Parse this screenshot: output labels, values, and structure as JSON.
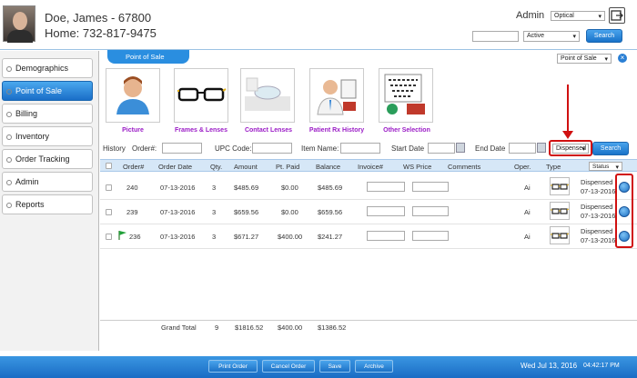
{
  "patient": {
    "name": "Doe, James - 67800",
    "home": "Home: 732-817-9475"
  },
  "header": {
    "admin_label": "Admin",
    "location_value": "Optical",
    "status_value": "Active",
    "search_label": "Search"
  },
  "sidebar": {
    "items": [
      {
        "label": "Demographics"
      },
      {
        "label": "Point of Sale"
      },
      {
        "label": "Billing"
      },
      {
        "label": "Inventory"
      },
      {
        "label": "Order Tracking"
      },
      {
        "label": "Admin"
      },
      {
        "label": "Reports"
      }
    ]
  },
  "pos": {
    "tab_label": "Point of Sale",
    "view_select": "Point of Sale"
  },
  "tiles": [
    {
      "label": "Picture"
    },
    {
      "label": "Frames & Lenses"
    },
    {
      "label": "Contact Lenses"
    },
    {
      "label": "Patient Rx History"
    },
    {
      "label": "Other Selection"
    }
  ],
  "filters": {
    "history_label": "History",
    "order_label": "Order#:",
    "upc_label": "UPC Code:",
    "item_label": "Item Name:",
    "start_label": "Start Date",
    "end_label": "End Date",
    "dispensed_value": "Dispensed",
    "search_label": "Search"
  },
  "table": {
    "headers": [
      "Order#",
      "Order Date",
      "Qty.",
      "Amount",
      "Pt. Paid",
      "Balance",
      "Invoice#",
      "WS Price",
      "Comments",
      "Oper.",
      "Type"
    ],
    "status_select": "Status",
    "rows": [
      {
        "order": "240",
        "date": "07-13-2016",
        "qty": "3",
        "amount": "$485.69",
        "paid": "$0.00",
        "balance": "$485.69",
        "oper": "Ai",
        "status": "Dispensed",
        "status_date": "07-13-2016",
        "flag": false
      },
      {
        "order": "239",
        "date": "07-13-2016",
        "qty": "3",
        "amount": "$659.56",
        "paid": "$0.00",
        "balance": "$659.56",
        "oper": "Ai",
        "status": "Dispensed",
        "status_date": "07-13-2016",
        "flag": false
      },
      {
        "order": "236",
        "date": "07-13-2016",
        "qty": "3",
        "amount": "$671.27",
        "paid": "$400.00",
        "balance": "$241.27",
        "oper": "Ai",
        "status": "Dispensed",
        "status_date": "07-13-2016",
        "flag": true
      }
    ],
    "totals": {
      "label": "Grand Total",
      "qty": "9",
      "amount": "$1816.52",
      "paid": "$400.00",
      "balance": "$1386.52"
    }
  },
  "footer": {
    "print_order": "Print Order",
    "cancel_order": "Cancel Order",
    "save": "Save",
    "archive": "Archive",
    "date": "Wed Jul 13, 2016",
    "time": "04:42:17 PM"
  },
  "colors": {
    "accent": "#1a6ec8",
    "tile_label": "#9b1cc6",
    "highlight": "#d01010"
  }
}
